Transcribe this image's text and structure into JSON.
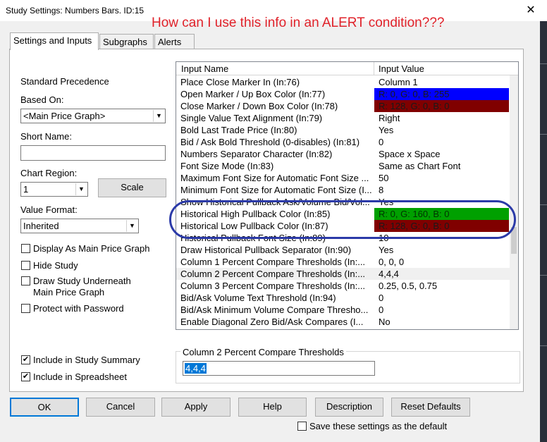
{
  "window": {
    "title": "Study Settings: Numbers Bars. ID:15",
    "close_glyph": "✕"
  },
  "annotation": "How can I use this info in an ALERT condition???",
  "tabs": [
    {
      "label": "Settings and Inputs"
    },
    {
      "label": "Subgraphs"
    },
    {
      "label": "Alerts"
    }
  ],
  "left": {
    "standard_precedence": "Standard Precedence",
    "based_on_label": "Based On:",
    "based_on_value": "<Main Price Graph>",
    "short_name_label": "Short Name:",
    "short_name_value": "",
    "chart_region_label": "Chart Region:",
    "chart_region_value": "1",
    "scale_button": "Scale",
    "value_format_label": "Value Format:",
    "value_format_value": "Inherited",
    "checks": [
      {
        "label": "Display As Main Price Graph",
        "checked": false
      },
      {
        "label": "Hide Study",
        "checked": false
      },
      {
        "label": "Draw Study Underneath Main Price Graph",
        "checked": false
      },
      {
        "label": "Protect with Password",
        "checked": false
      },
      {
        "label": "Include in Study Summary",
        "checked": true
      },
      {
        "label": "Include in Spreadsheet",
        "checked": true
      }
    ]
  },
  "grid": {
    "col_name": "Input Name",
    "col_value": "Input Value",
    "rows": [
      {
        "name": "Place Close Marker In   (In:76)",
        "value": "Column 1"
      },
      {
        "name": "Open Marker / Up Box Color   (In:77)",
        "value": "R: 0, G: 0, B: 255",
        "color": "#0000ff"
      },
      {
        "name": "Close Marker / Down Box Color   (In:78)",
        "value": "R: 128, G: 0, B: 0",
        "color": "#800000"
      },
      {
        "name": "Single Value Text Alignment   (In:79)",
        "value": "Right"
      },
      {
        "name": "Bold Last Trade Price   (In:80)",
        "value": "Yes"
      },
      {
        "name": "Bid / Ask Bold Threshold (0-disables)   (In:81)",
        "value": "0"
      },
      {
        "name": "Numbers Separator Character   (In:82)",
        "value": "Space x Space"
      },
      {
        "name": "Font Size Mode   (In:83)",
        "value": "Same as Chart Font"
      },
      {
        "name": "Maximum Font Size for Automatic Font Size   ...",
        "value": "50"
      },
      {
        "name": "Minimum Font Size for Automatic Font Size   (I...",
        "value": "8"
      },
      {
        "name": "Show Historical Pullback Ask/Volume Bid/Vol...",
        "value": "Yes"
      },
      {
        "name": "Historical High Pullback Color   (In:85)",
        "value": "R: 0, G: 160, B: 0",
        "color": "#00a000"
      },
      {
        "name": "Historical Low Pullback Color   (In:87)",
        "value": "R: 128, G: 0, B: 0",
        "color": "#800000"
      },
      {
        "name": "Historical Pullback Font Size   (In:89)",
        "value": "10"
      },
      {
        "name": "Draw Historical Pullback Separator   (In:90)",
        "value": "Yes"
      },
      {
        "name": "Column 1 Percent Compare Thresholds   (In:...",
        "value": "0, 0, 0"
      },
      {
        "name": "Column 2 Percent Compare Thresholds   (In:...",
        "value": "4,4,4",
        "selected": true
      },
      {
        "name": "Column 3 Percent Compare Thresholds   (In:...",
        "value": "0.25, 0.5, 0.75"
      },
      {
        "name": "Bid/Ask Volume Text Threshold   (In:94)",
        "value": "0"
      },
      {
        "name": "Bid/Ask Minimum Volume Compare Thresho...",
        "value": "0"
      },
      {
        "name": "Enable Diagonal Zero Bid/Ask Compares   (I...",
        "value": "No"
      }
    ]
  },
  "editor": {
    "title": "Column 2 Percent Compare Thresholds",
    "value": "4,4,4"
  },
  "buttons": {
    "ok": "OK",
    "cancel": "Cancel",
    "apply": "Apply",
    "help": "Help",
    "description": "Description",
    "reset": "Reset Defaults"
  },
  "save_default": {
    "label": "Save these settings as the default",
    "checked": false
  }
}
